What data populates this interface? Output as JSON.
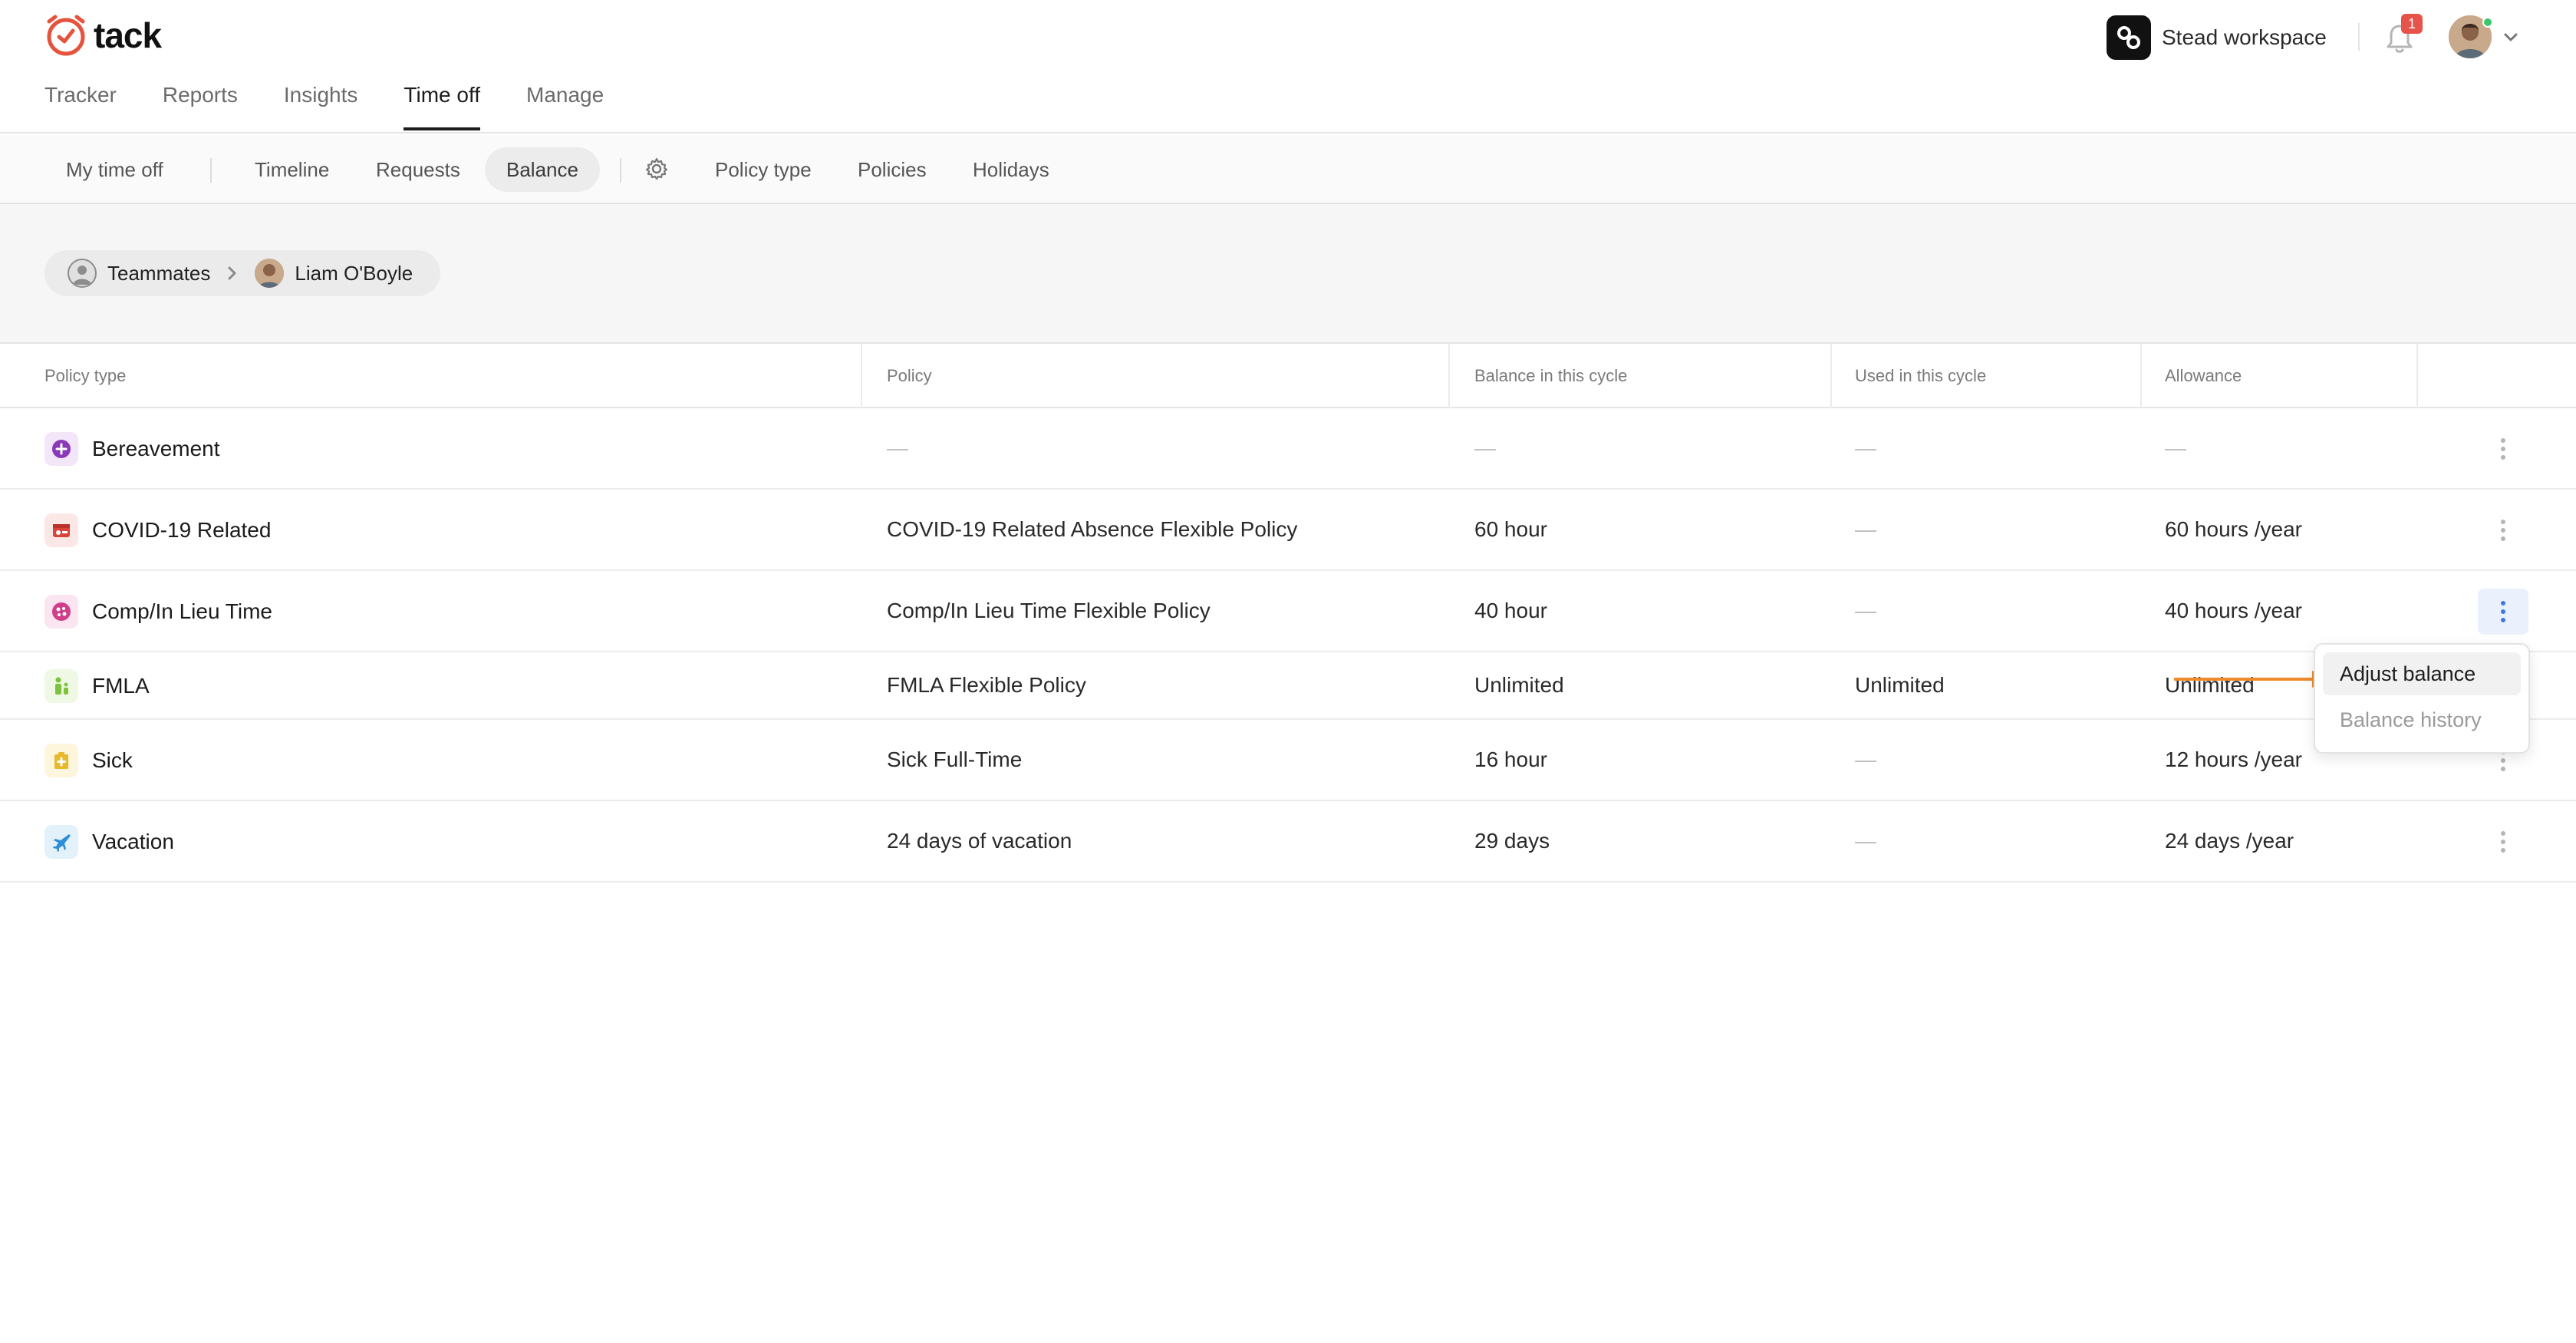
{
  "app": {
    "logo_text": "tack",
    "workspace": "Stead workspace",
    "notification_count": "1"
  },
  "main_tabs": [
    {
      "label": "Tracker"
    },
    {
      "label": "Reports"
    },
    {
      "label": "Insights"
    },
    {
      "label": "Time off",
      "active": true
    },
    {
      "label": "Manage"
    }
  ],
  "sub_nav": {
    "my_time_off": "My time off",
    "timeline": "Timeline",
    "requests": "Requests",
    "balance": "Balance",
    "policy_type": "Policy type",
    "policies": "Policies",
    "holidays": "Holidays"
  },
  "breadcrumb": {
    "root": "Teammates",
    "current": "Liam O'Boyle"
  },
  "table": {
    "headers": {
      "policy_type": "Policy type",
      "policy": "Policy",
      "balance": "Balance in this cycle",
      "used": "Used in this cycle",
      "allowance": "Allowance"
    },
    "rows": [
      {
        "policy_type": "Bereavement",
        "icon": "bereavement-icon",
        "icon_color": "#8a3ab9",
        "icon_bg": "#f3e6f8",
        "policy": "—",
        "balance": "—",
        "used": "—",
        "allowance": "—"
      },
      {
        "policy_type": "COVID-19 Related",
        "icon": "covid-icon",
        "icon_color": "#d9443a",
        "icon_bg": "#fbe7e5",
        "policy": "COVID-19 Related Absence Flexible Policy",
        "balance": "60 hour",
        "used": "—",
        "allowance": "60 hours /year"
      },
      {
        "policy_type": "Comp/In Lieu Time",
        "icon": "comp-time-icon",
        "icon_color": "#d0408a",
        "icon_bg": "#fbe5f1",
        "policy": "Comp/In Lieu Time Flexible Policy",
        "balance": "40 hour",
        "used": "—",
        "allowance": "40 hours /year"
      },
      {
        "policy_type": "FMLA",
        "icon": "fmla-icon",
        "icon_color": "#7cc23c",
        "icon_bg": "#eef8e4",
        "policy": "FMLA Flexible Policy",
        "balance": "Unlimited",
        "used": "Unlimited",
        "allowance": "Unlimited"
      },
      {
        "policy_type": "Sick",
        "icon": "sick-icon",
        "icon_color": "#e8b92c",
        "icon_bg": "#fdf5dc",
        "policy": "Sick Full-Time",
        "balance": "16 hour",
        "used": "—",
        "allowance": "12 hours /year"
      },
      {
        "policy_type": "Vacation",
        "icon": "vacation-icon",
        "icon_color": "#2e8fd6",
        "icon_bg": "#e3f1fb",
        "policy": "24 days of vacation",
        "balance": "29 days",
        "used": "—",
        "allowance": "24 days /year"
      }
    ]
  },
  "row_menu": {
    "adjust_balance": "Adjust balance",
    "balance_history": "Balance history"
  },
  "colors": {
    "accent": "#3b79e3",
    "logo": "#e5533d",
    "annotation_arrow": "#ef8a2a"
  }
}
